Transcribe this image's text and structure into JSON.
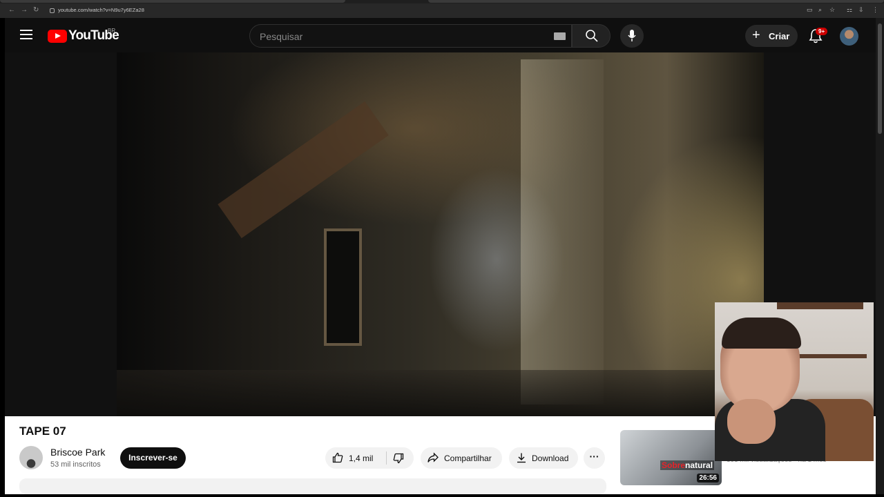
{
  "browser": {
    "url": "youtube.com/watch?v=N9u7y6EZa28"
  },
  "header": {
    "logo_text": "YouTube",
    "country_code": "BR",
    "search_placeholder": "Pesquisar",
    "create_label": "Criar",
    "notification_badge": "9+"
  },
  "video": {
    "title": "TAPE 07"
  },
  "channel": {
    "name": "Briscoe Park",
    "subscribers": "53 mil inscritos",
    "subscribe_label": "Inscrever-se"
  },
  "actions": {
    "like_count": "1,4 mil",
    "share_label": "Compartilhar",
    "download_label": "Download",
    "more_label": "···"
  },
  "recommendation": {
    "thumbnail_brand_part1": "Sobre",
    "thumbnail_brand_part2": "natural",
    "duration": "26:56",
    "meta": "303 mil visualizações • há 1 mês"
  },
  "colors": {
    "brand_red": "#ff0000",
    "page_bg": "#0f0f0f",
    "subscribe_bg": "#0f0f0f"
  }
}
